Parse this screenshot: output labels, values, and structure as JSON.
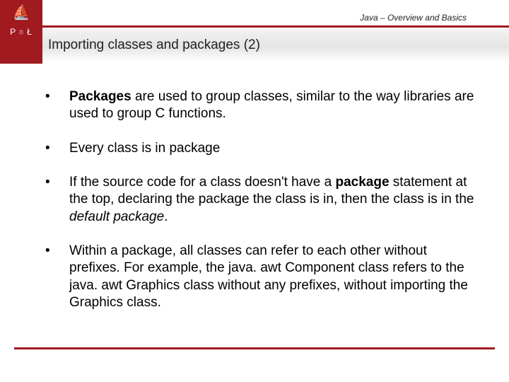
{
  "header": {
    "course_title": "Java – Overview and Basics",
    "logo": {
      "ship": "⛵",
      "p": "P",
      "gear": "☼",
      "l": "Ł"
    }
  },
  "slide": {
    "title": "Importing classes and packages (2)"
  },
  "bullets": {
    "b0": {
      "lead_bold": "Packages",
      "rest": " are used to group classes, similar to the way libraries are used to group C functions."
    },
    "b1": {
      "text": "Every class is in package"
    },
    "b2": {
      "pre": "If the source code for a class doesn't have a ",
      "kw1": "package",
      "mid": " statement at the top, declaring the package the class is in, then the class is in the ",
      "kw2": "default package",
      "post": "."
    },
    "b3": {
      "text": "Within a package, all classes can refer to each other without prefixes. For example, the java. awt Component class refers to the java. awt Graphics class without any prefixes, without importing the Graphics class."
    }
  }
}
